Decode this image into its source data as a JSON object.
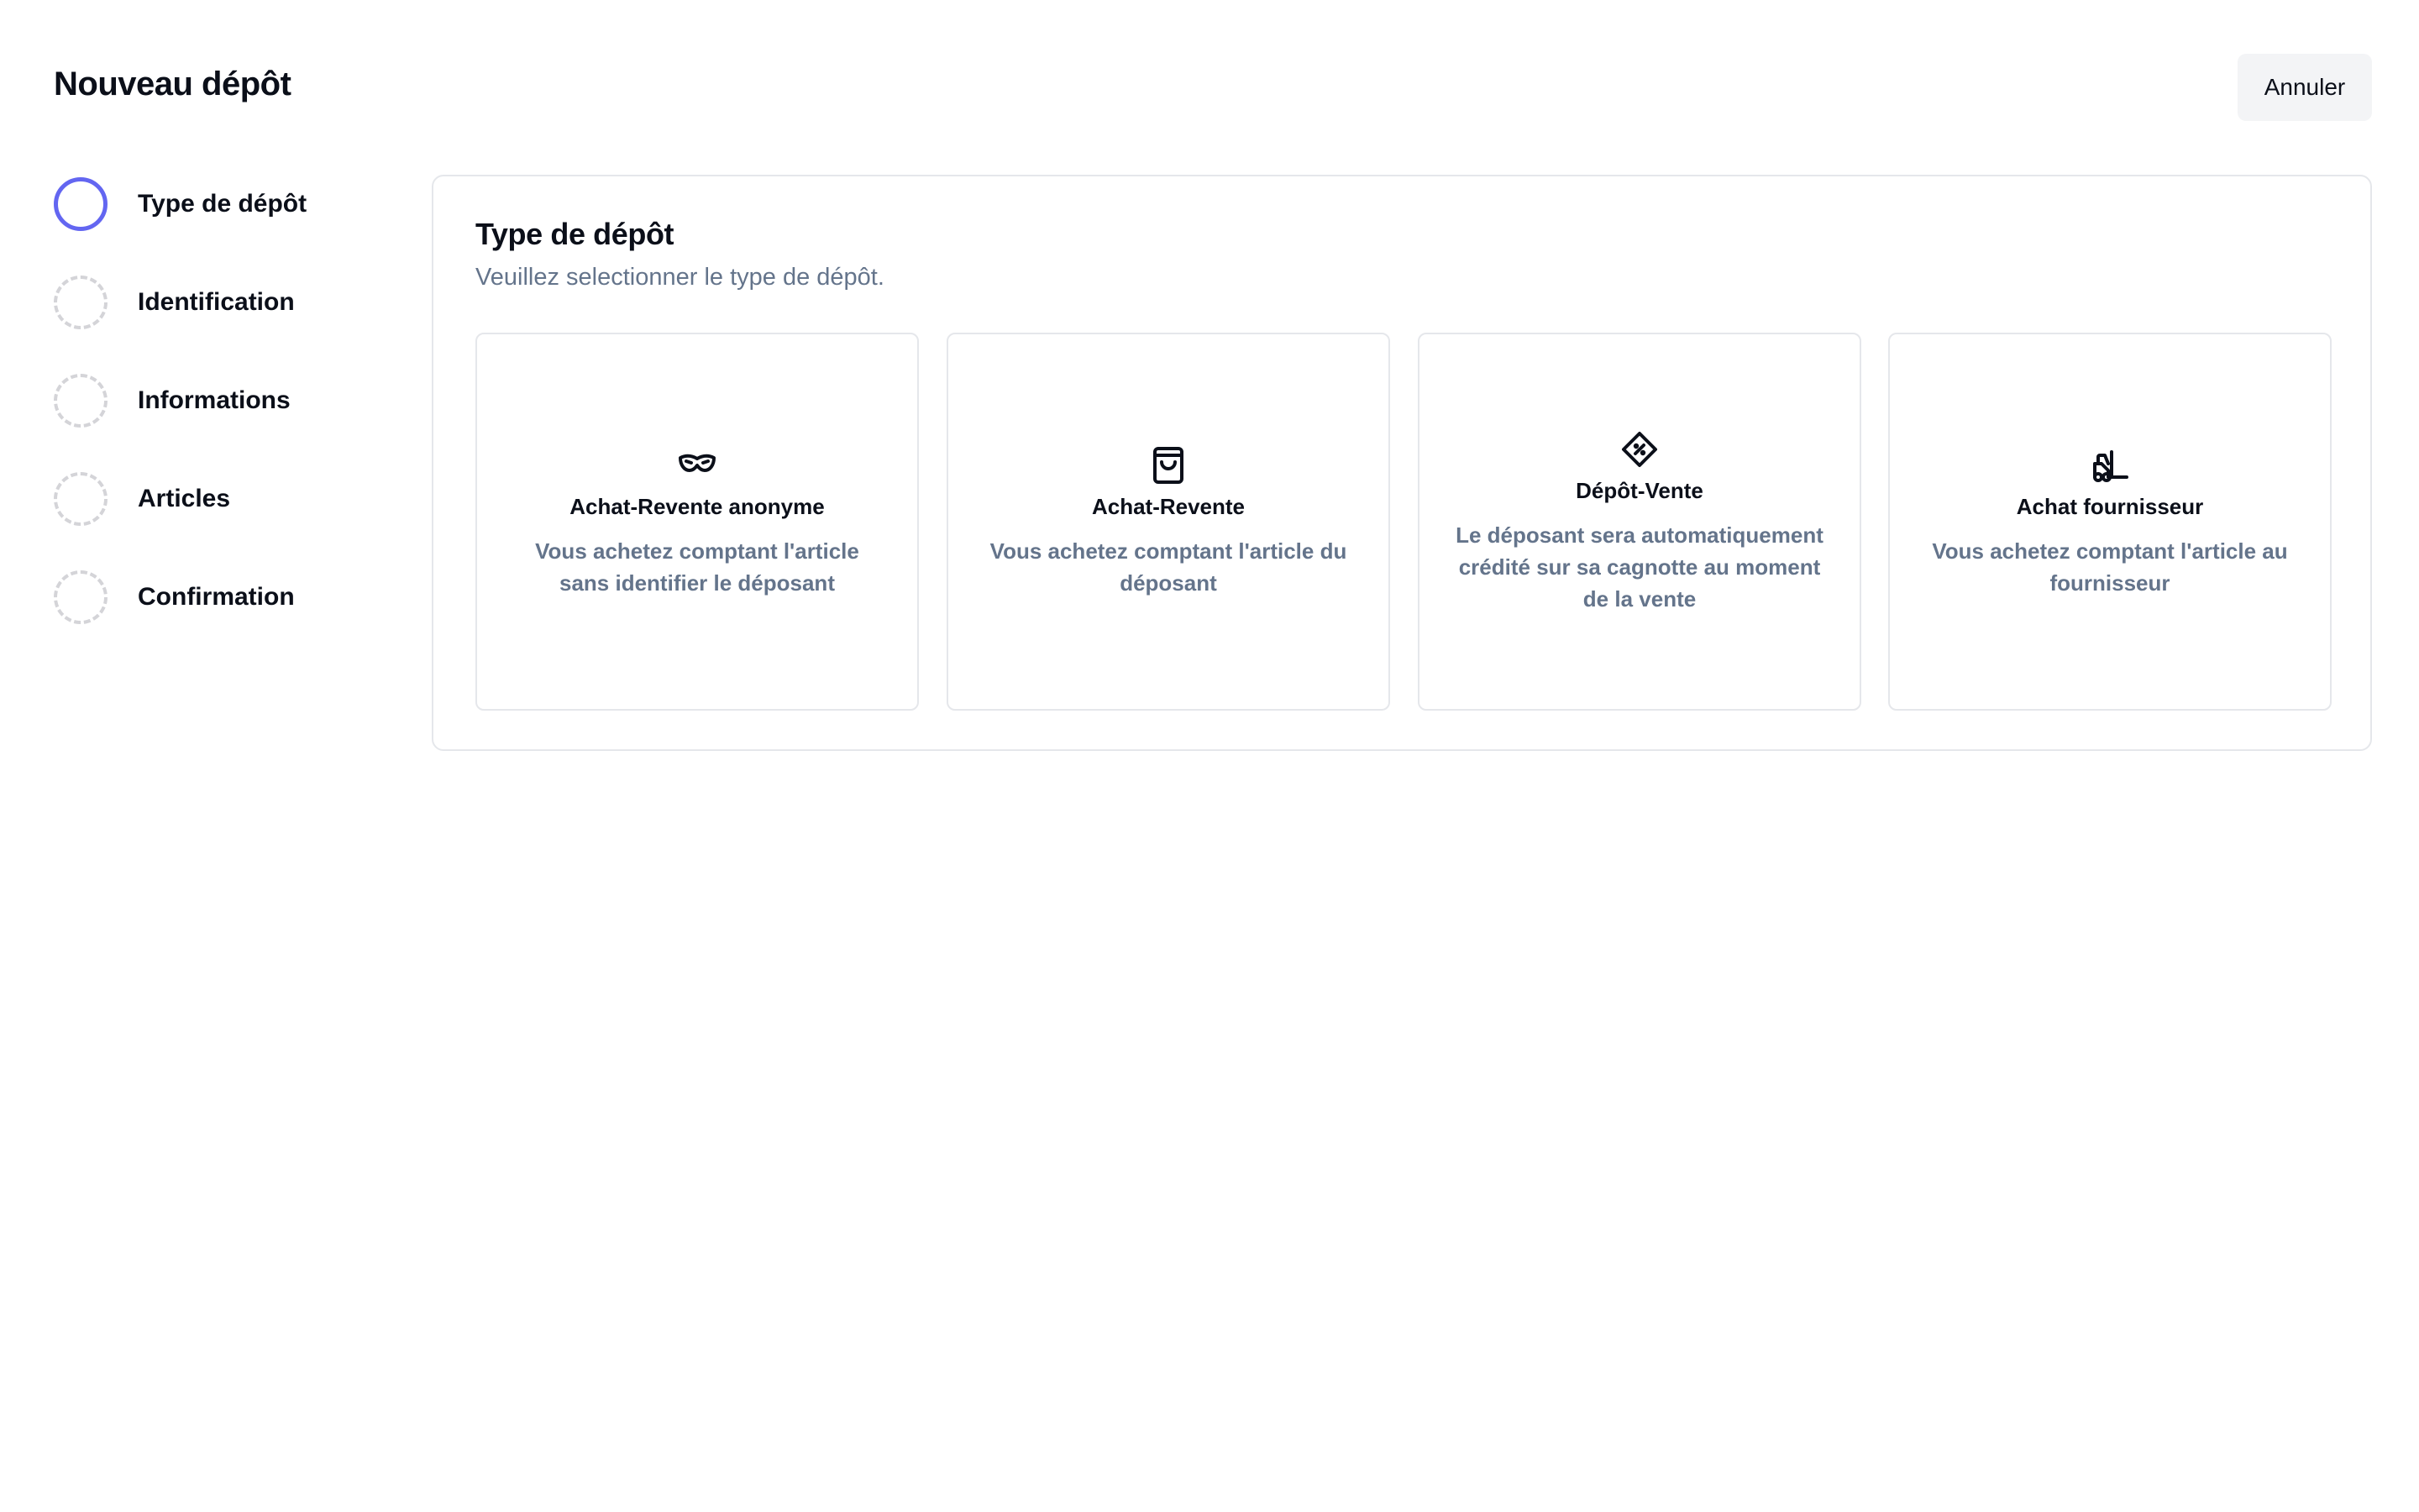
{
  "header": {
    "title": "Nouveau dépôt",
    "cancel_label": "Annuler"
  },
  "stepper": {
    "steps": [
      {
        "label": "Type de dépôt",
        "state": "active"
      },
      {
        "label": "Identification",
        "state": "pending"
      },
      {
        "label": "Informations",
        "state": "pending"
      },
      {
        "label": "Articles",
        "state": "pending"
      },
      {
        "label": "Confirmation",
        "state": "pending"
      }
    ]
  },
  "card": {
    "title": "Type de dépôt",
    "subtitle": "Veuillez selectionner le type de dépôt.",
    "options": [
      {
        "icon": "mask-icon",
        "title": "Achat-Revente anonyme",
        "description": "Vous achetez comptant l'article sans identifier le déposant"
      },
      {
        "icon": "shopping-bag-icon",
        "title": "Achat-Revente",
        "description": "Vous achetez comptant l'article du déposant"
      },
      {
        "icon": "discount-tag-icon",
        "title": "Dépôt-Vente",
        "description": "Le déposant sera automatiquement crédité sur sa cagnotte au moment de la vente"
      },
      {
        "icon": "forklift-icon",
        "title": "Achat fournisseur",
        "description": "Vous achetez comptant l'article au fournisseur"
      }
    ]
  },
  "colors": {
    "accent": "#6366f1",
    "muted_text": "#64748b",
    "border": "#e5e7eb",
    "button_bg": "#f3f4f6"
  }
}
